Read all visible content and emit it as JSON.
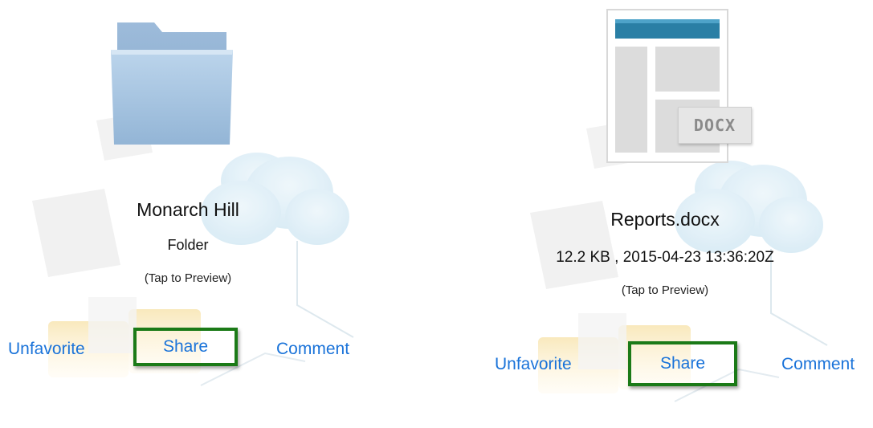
{
  "items": [
    {
      "name": "Monarch Hill",
      "detail": "Folder",
      "hint": "(Tap to Preview)",
      "actions": {
        "unfavorite": "Unfavorite",
        "share": "Share",
        "comment": "Comment"
      },
      "icon": "folder-icon"
    },
    {
      "name": "Reports.docx",
      "detail": "12.2 KB , 2015-04-23 13:36:20Z",
      "hint": "(Tap to Preview)",
      "actions": {
        "unfavorite": "Unfavorite",
        "share": "Share",
        "comment": "Comment"
      },
      "icon": "docx-file-icon",
      "badge": "DOCX"
    }
  ],
  "colors": {
    "accent": "#1a73d9",
    "highlight": "#1b7a17",
    "folder": "#a8c6e2",
    "docx_bar": "#2a7fa5"
  }
}
